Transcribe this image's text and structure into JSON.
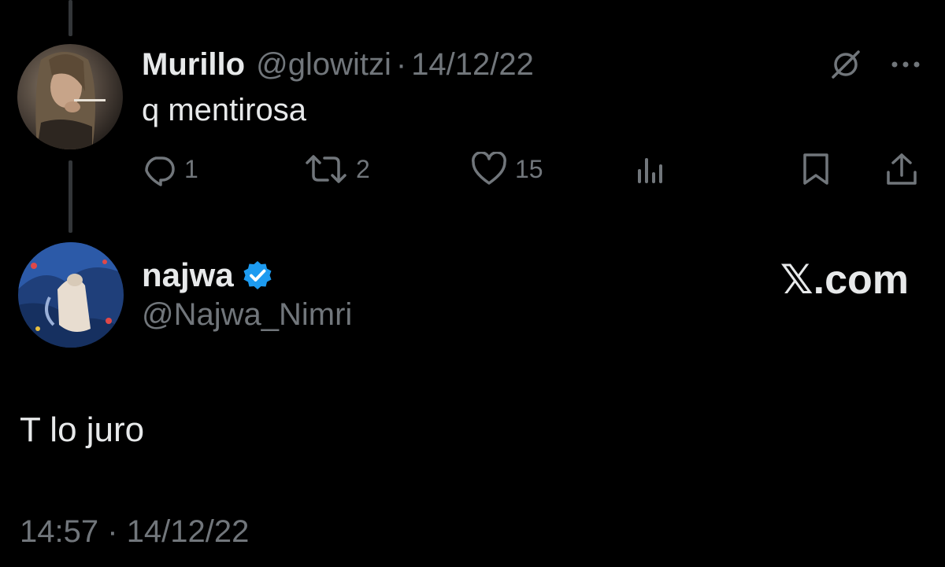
{
  "reply_tweet": {
    "display_name": "Murillo",
    "handle": "@glowitzi",
    "separator": "·",
    "date": "14/12/22",
    "text": "q mentirosa",
    "actions": {
      "reply_count": "1",
      "retweet_count": "2",
      "like_count": "15"
    }
  },
  "main_tweet": {
    "display_name": "najwa",
    "handle": "@Najwa_Nimri",
    "verified": true,
    "text": "T lo juro",
    "time": "14:57",
    "separator": "·",
    "date": "14/12/22"
  },
  "branding": {
    "logo_text": "𝕏.com"
  },
  "icons": {
    "grok": "grok-icon",
    "more": "more-icon",
    "reply": "reply-icon",
    "retweet": "retweet-icon",
    "like": "heart-icon",
    "views": "views-icon",
    "bookmark": "bookmark-icon",
    "share": "share-icon",
    "verified": "verified-badge-icon"
  },
  "colors": {
    "background": "#000000",
    "primary_text": "#e7e9ea",
    "secondary_text": "#71767b",
    "verified_blue": "#1d9bf0"
  }
}
